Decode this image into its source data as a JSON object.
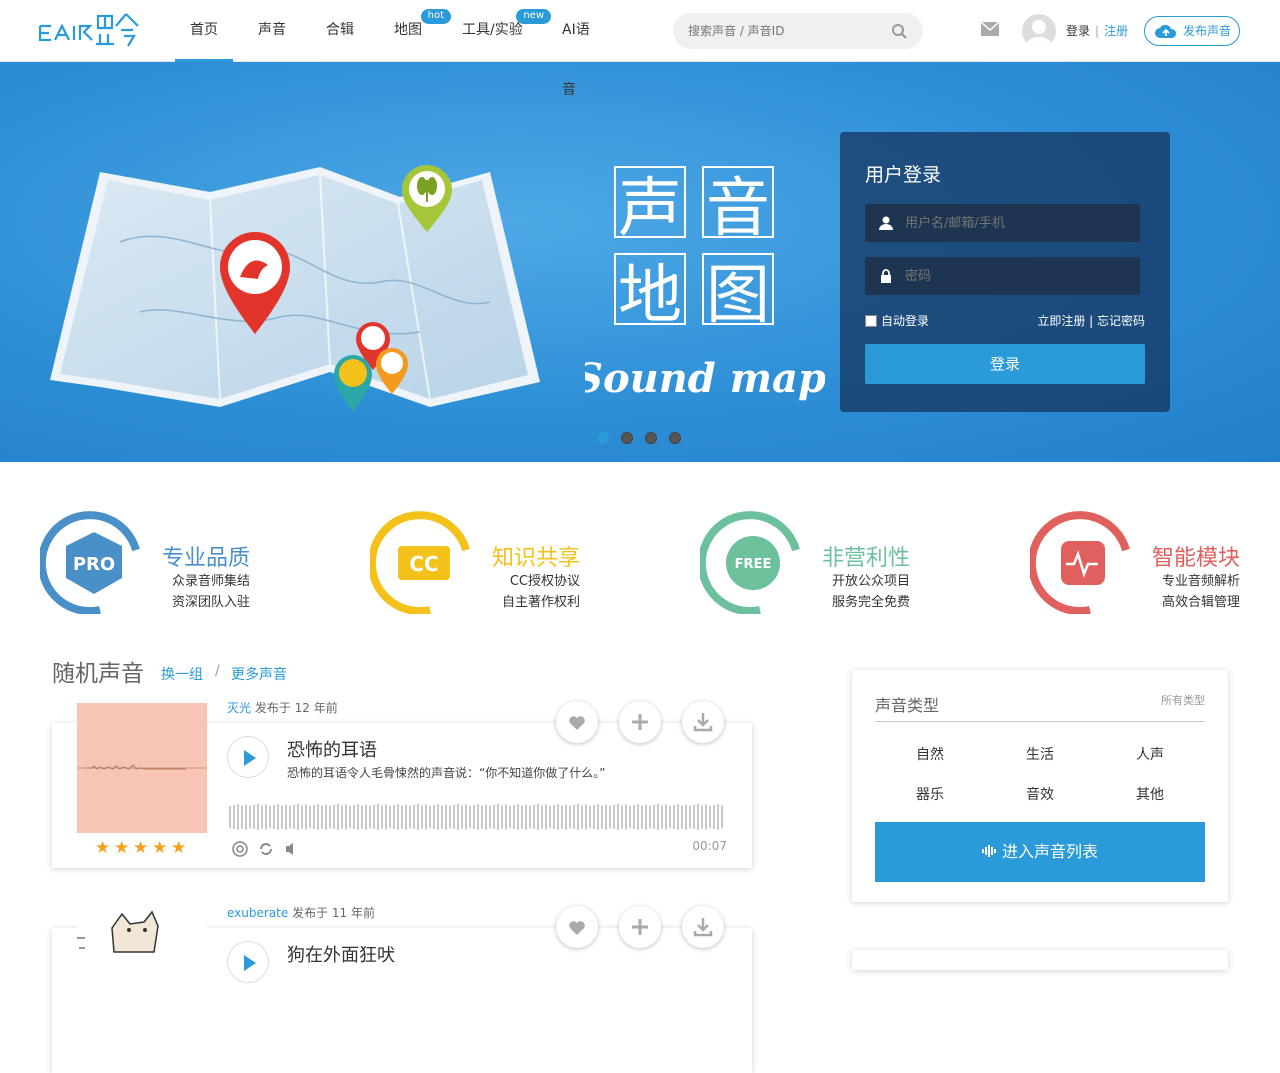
{
  "header": {
    "logo_text": "EAR聆",
    "nav": [
      {
        "label": "首页",
        "active": true
      },
      {
        "label": "声音",
        "badge": ""
      },
      {
        "label": "合辑",
        "badge": ""
      },
      {
        "label": "地图",
        "badge": "hot"
      },
      {
        "label": "工具/实验",
        "badge": "new"
      },
      {
        "label": "AI语音",
        "badge": ""
      }
    ],
    "search_placeholder": "搜索声音 / 声音ID",
    "login": "登录",
    "sep": "|",
    "register": "注册",
    "publish": "发布声音"
  },
  "banner": {
    "title_chars": [
      "声",
      "音",
      "地",
      "图"
    ],
    "subtitle": "Sound map",
    "dots": 4,
    "active_dot": 0
  },
  "login_box": {
    "title": "用户登录",
    "username_placeholder": "用户名/邮箱/手机",
    "password_placeholder": "密码",
    "auto_login": "自动登录",
    "links": "立即注册 | 忘记密码",
    "button": "登录"
  },
  "features": [
    {
      "title": "专业品质",
      "icon": "PRO",
      "line1": "众录音师集结",
      "line2": "资深团队入驻",
      "color": "#4a90c8"
    },
    {
      "title": "知识共享",
      "icon": "CC",
      "line1": "CC授权协议",
      "line2": "自主著作权利",
      "color": "#f3c11a"
    },
    {
      "title": "非营利性",
      "icon": "FREE",
      "line1": "开放公众项目",
      "line2": "服务完全免费",
      "color": "#6cc19c"
    },
    {
      "title": "智能模块",
      "icon": "pulse-icon",
      "line1": "专业音频解析",
      "line2": "高效合辑管理",
      "color": "#e0605e"
    }
  ],
  "section": {
    "title": "随机声音",
    "change": "换一组",
    "slash": "/",
    "more": "更多声音"
  },
  "sounds": [
    {
      "user": "灭光",
      "posted": "发布于 12 年前",
      "title": "恐怖的耳语",
      "desc": "恐怖的耳语令人毛骨悚然的声音说：“你不知道你做了什么。”",
      "duration": "00:07",
      "stars": 5
    },
    {
      "user": "exuberate",
      "posted": "发布于 11 年前",
      "title": "狗在外面狂吠",
      "desc": "",
      "duration": "",
      "stars": 0
    }
  ],
  "sidebar": {
    "title": "声音类型",
    "all": "所有类型",
    "categories": [
      "自然",
      "生活",
      "人声",
      "器乐",
      "音效",
      "其他"
    ],
    "enter": "进入声音列表"
  }
}
